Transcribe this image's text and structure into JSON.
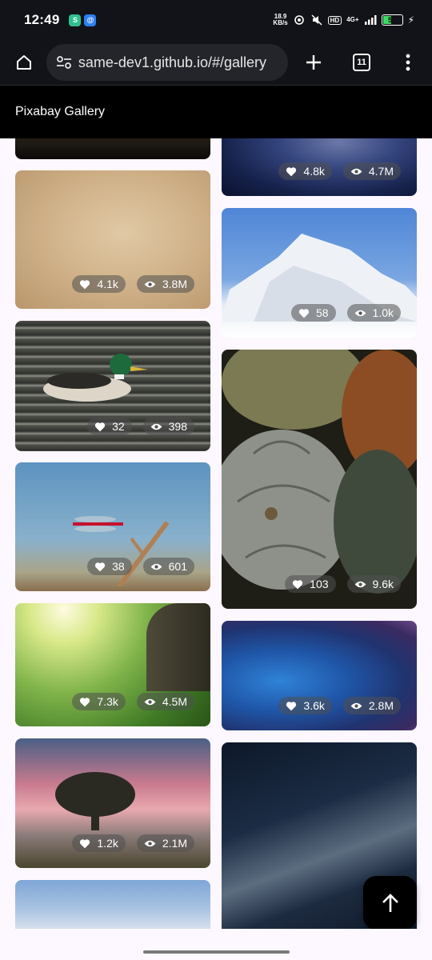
{
  "status_bar": {
    "time": "12:49",
    "net_speed_value": "18.9",
    "net_speed_unit": "KB/s",
    "hd_badge": "HD",
    "signal_label": "4G+",
    "battery_level": "51",
    "battery_fraction": 0.51
  },
  "browser": {
    "url": "same-dev1.github.io/#/gallery",
    "tab_count": "11"
  },
  "app": {
    "title": "Pixabay Gallery"
  },
  "gallery": {
    "left_column": [
      {
        "name": "dark-landscape",
        "likes": "",
        "views": ""
      },
      {
        "name": "parchment-texture",
        "likes": "4.1k",
        "views": "3.8M"
      },
      {
        "name": "mallard-duck",
        "likes": "32",
        "views": "398"
      },
      {
        "name": "red-dragonfly",
        "likes": "38",
        "views": "601"
      },
      {
        "name": "sunny-meadow",
        "likes": "7.3k",
        "views": "4.5M"
      },
      {
        "name": "lone-tree-sunset",
        "likes": "1.2k",
        "views": "2.1M"
      },
      {
        "name": "winter-landscape",
        "likes": "",
        "views": ""
      }
    ],
    "right_column": [
      {
        "name": "starry-sky",
        "likes": "4.8k",
        "views": "4.7M"
      },
      {
        "name": "snowy-trees",
        "likes": "58",
        "views": "1.0k"
      },
      {
        "name": "pumpkins",
        "likes": "103",
        "views": "9.6k"
      },
      {
        "name": "storm-clouds",
        "likes": "3.6k",
        "views": "2.8M"
      },
      {
        "name": "milky-way",
        "likes": "",
        "views": ""
      }
    ]
  },
  "icons": {
    "home": "home-icon",
    "site_settings": "tune-icon",
    "new_tab": "plus-icon",
    "menu": "more-vert-icon",
    "like": "heart-icon",
    "views": "eye-icon",
    "scroll_top": "arrow-up-icon"
  }
}
